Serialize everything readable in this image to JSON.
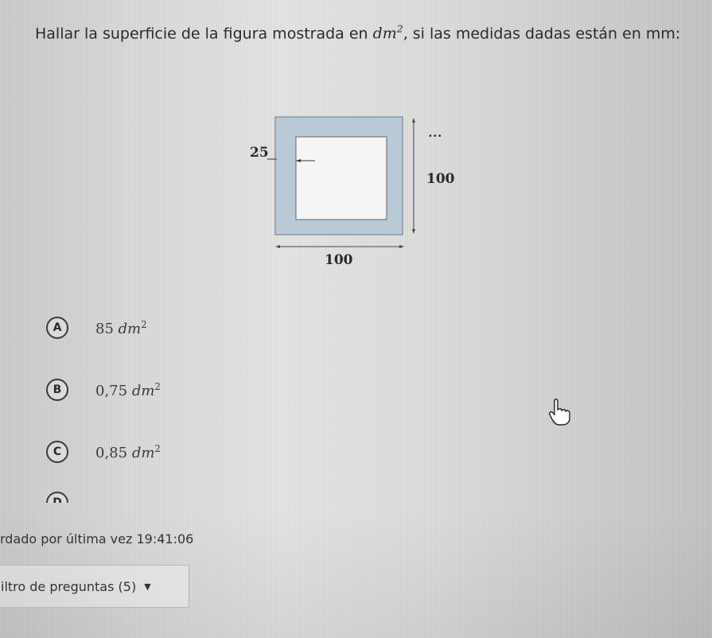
{
  "question": {
    "prefix": "Hallar la superficie de la figura mostrada en ",
    "unit_base": "dm",
    "unit_exp": "2",
    "suffix": ", si las medidas dadas están en mm:"
  },
  "figure": {
    "label_border": "25",
    "label_height": "100",
    "label_width": "100",
    "outer_color": "#b9c9d6",
    "inner_color": "#f4f5f4",
    "dots": "•••"
  },
  "options": [
    {
      "letter": "A",
      "value": "85 ",
      "unit": "dm",
      "exp": "2"
    },
    {
      "letter": "B",
      "value": "0,75 ",
      "unit": "dm",
      "exp": "2"
    },
    {
      "letter": "C",
      "value": "0,85 ",
      "unit": "dm",
      "exp": "2"
    },
    {
      "letter": "D",
      "value": "",
      "unit": "",
      "exp": ""
    }
  ],
  "saved": {
    "label": "rdado por última vez ",
    "time": "19:41:06"
  },
  "filter": {
    "label": "iltro de preguntas (5)"
  }
}
